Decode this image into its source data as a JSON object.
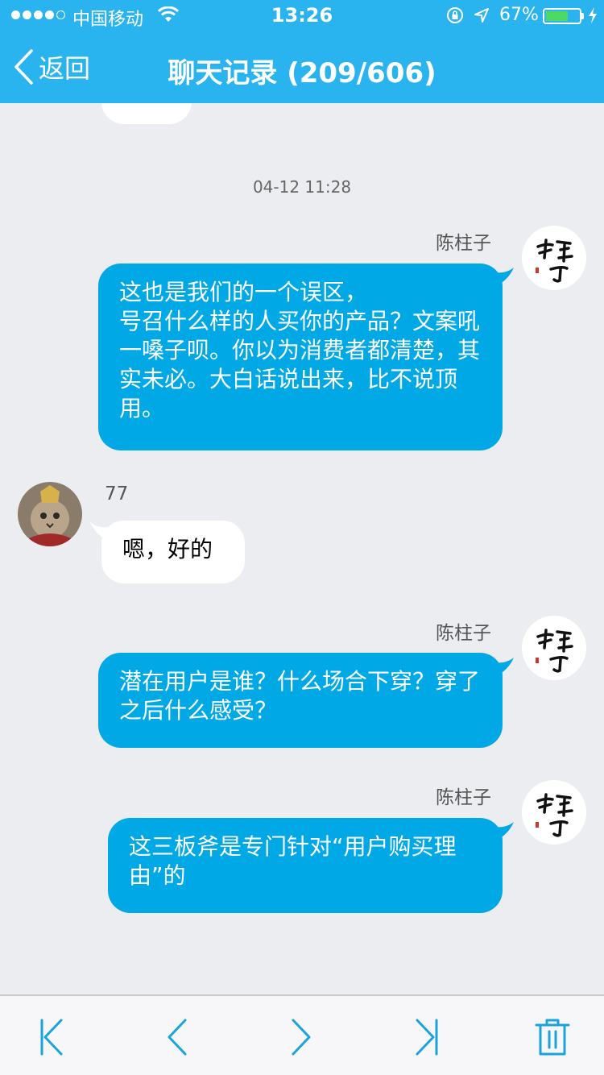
{
  "status_bar": {
    "carrier": "中国移动",
    "time": "13:26",
    "battery_percent": "67%",
    "battery_level": 0.67,
    "signal_bars": 4,
    "icons": [
      "wifi-icon",
      "orientation-lock-icon",
      "location-icon",
      "battery-icon",
      "charging-icon"
    ]
  },
  "nav": {
    "back_label": "返回",
    "title": "聊天记录 (209/606)"
  },
  "chat": {
    "timestamp": "04-12 11:28",
    "messages": [
      {
        "sender": "陈柱子",
        "direction": "outgoing",
        "text": "这也是我们的一个误区，\n号召什么样的人买你的产品？文案吼一嗓子呗。你以为消费者都清楚，其实未必。大白话说出来，比不说顶用。"
      },
      {
        "sender": "77",
        "direction": "incoming",
        "text": "嗯，好的"
      },
      {
        "sender": "陈柱子",
        "direction": "outgoing",
        "text": "潜在用户是谁？什么场合下穿？穿了之后什么感受？"
      },
      {
        "sender": "陈柱子",
        "direction": "outgoing",
        "text": "这三板斧是专门针对“用户购买理由”的"
      }
    ]
  },
  "toolbar": {
    "buttons": [
      "first-page-icon",
      "previous-page-icon",
      "next-page-icon",
      "last-page-icon",
      "trash-icon"
    ]
  },
  "colors": {
    "nav_blue": "#29b4f0",
    "outgoing_bubble": "#00a8e6",
    "incoming_bubble": "#ffffff",
    "chat_background": "#ebedf1",
    "toolbar_icon": "#1aa3dd"
  }
}
